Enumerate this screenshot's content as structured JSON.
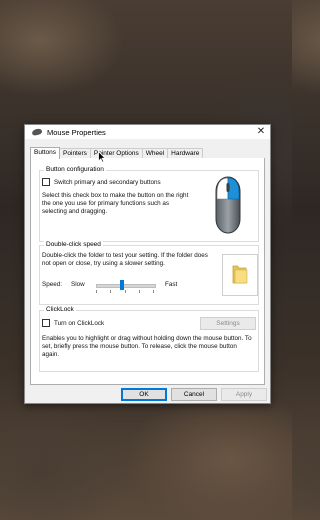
{
  "window": {
    "title": "Mouse Properties",
    "close_glyph": "✕"
  },
  "tabs": [
    {
      "label": "Buttons",
      "active": true
    },
    {
      "label": "Pointers",
      "active": false
    },
    {
      "label": "Pointer Options",
      "active": false
    },
    {
      "label": "Wheel",
      "active": false
    },
    {
      "label": "Hardware",
      "active": false
    }
  ],
  "button_configuration": {
    "title": "Button configuration",
    "checkbox_label": "Switch primary and secondary buttons",
    "checked": false,
    "description": "Select this check box to make the button on the right the one you use for primary functions such as selecting and dragging."
  },
  "double_click": {
    "title": "Double-click speed",
    "description": "Double-click the folder to test your setting. If the folder does not open or close, try using a slower setting.",
    "speed_label": "Speed:",
    "slow_label": "Slow",
    "fast_label": "Fast",
    "speed_level": 0.45
  },
  "clicklock": {
    "title": "ClickLock",
    "checkbox_label": "Turn on ClickLock",
    "checked": false,
    "settings_label": "Settings",
    "description": "Enables you to highlight or drag without holding down the mouse button. To set, briefly press the mouse button. To release, click the mouse button again."
  },
  "footer": {
    "ok": "OK",
    "cancel": "Cancel",
    "apply": "Apply"
  },
  "colors": {
    "accent": "#0078d7",
    "folder": "#f3d46b"
  },
  "icons": [
    "mouse-icon",
    "close-icon",
    "mouse-illustration-icon",
    "folder-icon",
    "cursor-icon"
  ]
}
